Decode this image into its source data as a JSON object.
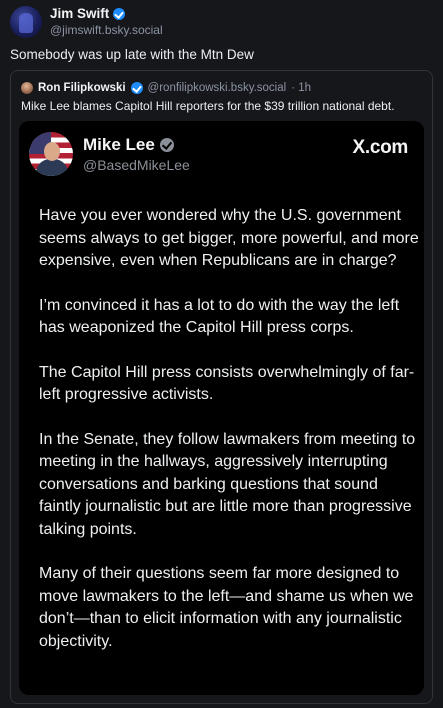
{
  "post": {
    "author_name": "Jim Swift",
    "author_handle": "@jimswift.bsky.social",
    "text": "Somebody was up late with the Mtn Dew"
  },
  "quote": {
    "author_name": "Ron Filipkowski",
    "author_handle": "@ronfilipkowski.bsky.social",
    "time": "· 1h",
    "text": "Mike Lee blames Capitol Hill reporters for the $39 trillion national debt."
  },
  "embedded_tweet": {
    "source": "X.com",
    "author_name": "Mike Lee",
    "author_handle": "@BasedMikeLee",
    "paragraphs": [
      "Have you ever wondered why the U.S. government seems always to get bigger, more powerful, and more expensive, even when Republicans are in charge?",
      "I’m convinced it has a lot to do with the way the left has weaponized the Capitol Hill press corps.",
      "The Capitol Hill press consists overwhelmingly of far-left progressive activists.",
      "In the Senate, they follow lawmakers from meeting to meeting in the hallways, aggressively interrupting conversations and barking questions that sound faintly journalistic but are little more than progressive talking points.",
      "Many of their questions seem far more designed to move lawmakers to the left—and shame us when we don’t—than to elicit information with any journalistic objectivity."
    ]
  },
  "colors": {
    "background": "#16171b",
    "verified_badge": "#1d8cff",
    "muted_text": "#8c93a3"
  }
}
